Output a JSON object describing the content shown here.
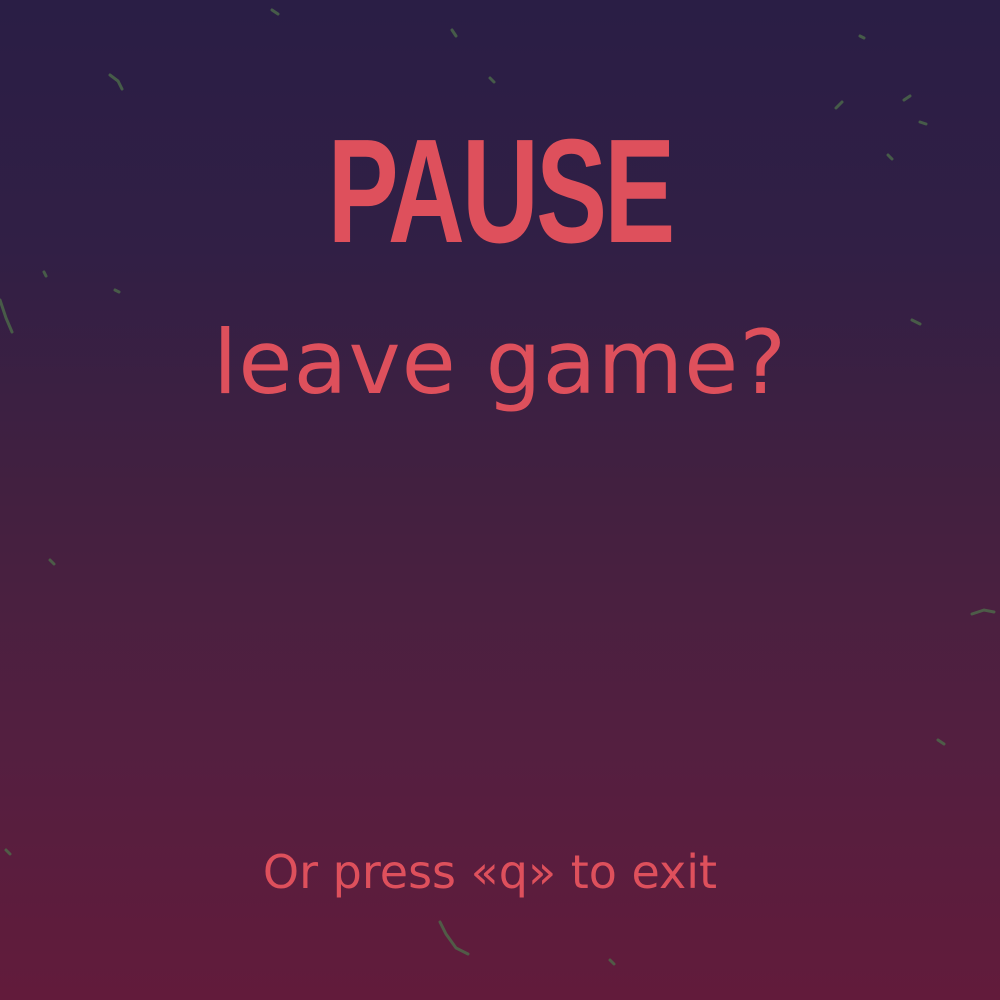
{
  "pause_menu": {
    "title": "PAUSE",
    "leave_prompt": "leave game?",
    "exit_hint": "Or press «q» to exit"
  },
  "colors": {
    "text": "#de505c",
    "background_top": "#2a1e45",
    "background_bottom": "#621b3b",
    "debris": "#4d6b4a"
  }
}
